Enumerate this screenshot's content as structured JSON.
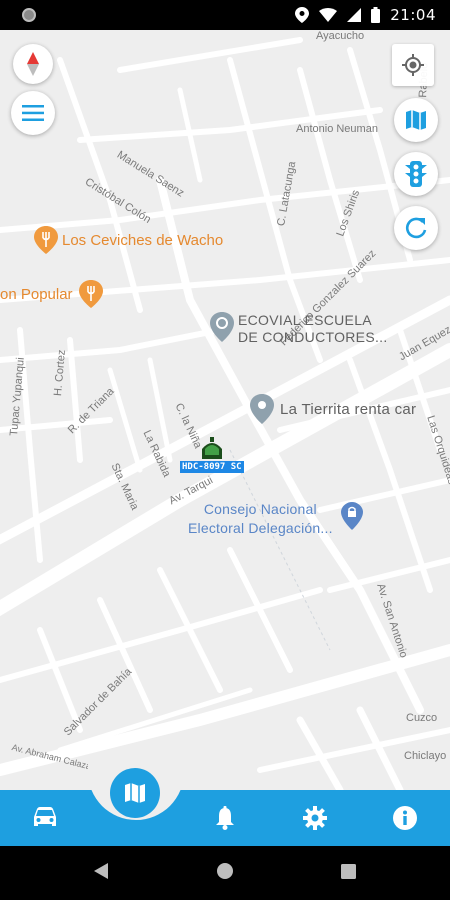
{
  "status_bar": {
    "time": "21:04"
  },
  "map": {
    "streets": [
      "Ayacucho",
      "Antonio Neuman",
      "Manuela Saenz",
      "Cristóbal Colón",
      "C. Latacunga",
      "Los Shiris",
      "Federico Gonzalez Suarez",
      "Juan Equez",
      "Tupac Yupanqui",
      "H. Cortez",
      "R. de Triana",
      "C. la Niña",
      "La Rabida",
      "Sta. Maria",
      "Av. Tarqui",
      "Las Orquideas",
      "Av. San Antonio",
      "Salvador de Bahía",
      "Av. Abraham Calazacón",
      "Cuzco",
      "Chiclayo",
      "Pedro Rabelo"
    ],
    "pois": {
      "ceviches": "Los Ceviches de Wacho",
      "popular": "on Popular",
      "ecovial_line1": "ECOVIAL ESCUELA",
      "ecovial_line2": "DE CONDUCTORES...",
      "tierrita": "La Tierrita renta car",
      "consejo_line1": "Consejo Nacional",
      "consejo_line2": "Electoral Delegación..."
    },
    "vehicle": {
      "plate": "HDC-8097 SC"
    },
    "controls": {
      "compass": "compass-icon",
      "menu": "menu-icon",
      "my_location": "my-location-icon",
      "map_layers": "map-icon",
      "traffic": "traffic-light-icon",
      "refresh": "refresh-icon"
    }
  },
  "bottom_nav": {
    "items": [
      "car-icon",
      "map-icon",
      "bell-icon",
      "gear-icon",
      "info-icon"
    ],
    "active": "map-icon",
    "color": "#1e9fe0"
  },
  "colors": {
    "accent": "#1e9fe0",
    "poi_food": "#e5892f",
    "poi_place": "#5a86c7"
  }
}
